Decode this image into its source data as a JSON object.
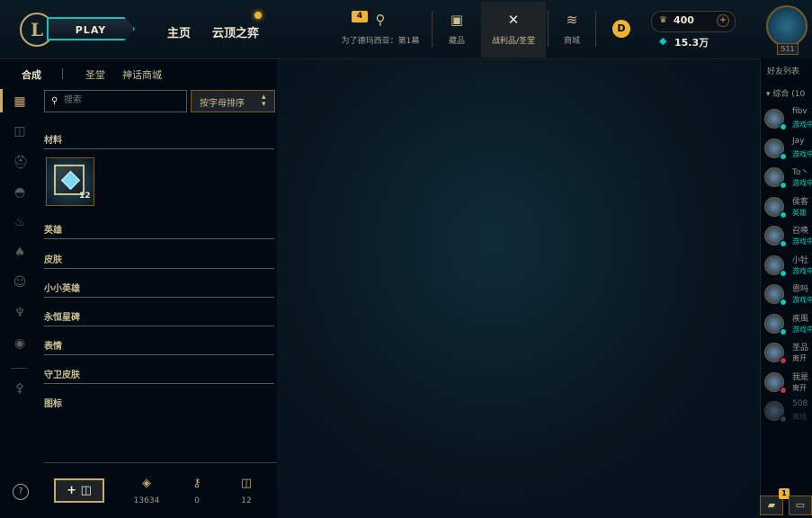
{
  "header": {
    "logo_letter": "L",
    "play_label": "PLAY",
    "nav": [
      "主页",
      "云顶之弈"
    ],
    "mission_badge": "4",
    "mission_label": "为了德玛西亚：第1幕",
    "tabs": [
      "藏品",
      "战利品/圣堂",
      "商城"
    ],
    "rp_coin_letter": "D",
    "rp_value": "400",
    "be_value": "15.3万",
    "level": "511"
  },
  "loot_tabs": [
    "合成",
    "圣堂",
    "神话商城"
  ],
  "search": {
    "placeholder": "搜索",
    "value": ""
  },
  "sort_label": "按字母排序",
  "categories": [
    "材料",
    "英雄",
    "皮肤",
    "小小英雄",
    "永恒星碑",
    "表情",
    "守卫皮肤",
    "图标"
  ],
  "loot_item": {
    "count": "12"
  },
  "bottom": {
    "craft_label": "+",
    "stats": [
      {
        "icon": "orange-essence-icon",
        "value": "13634"
      },
      {
        "icon": "key-icon",
        "value": "0"
      },
      {
        "icon": "chest-icon",
        "value": "12"
      }
    ]
  },
  "help_label": "?",
  "friends": {
    "title": "好友列表",
    "group_label": "综合 (10",
    "list": [
      {
        "name": "fibv",
        "status": "游戏中",
        "status_color": "#0ac8b9",
        "dot": "#0ac8b9"
      },
      {
        "name": "Jay",
        "status": "游戏中",
        "status_color": "#0ac8b9",
        "dot": "#0ac8b9"
      },
      {
        "name": "To丶",
        "status": "游戏中",
        "status_color": "#0ac8b9",
        "dot": "#0ac8b9"
      },
      {
        "name": "侯客",
        "status": "英雄",
        "status_color": "#0ac8b9",
        "dot": "#0ac8b9"
      },
      {
        "name": "召唤",
        "status": "游戏中",
        "status_color": "#0ac8b9",
        "dot": "#0ac8b9"
      },
      {
        "name": "小牡",
        "status": "游戏中",
        "status_color": "#0ac8b9",
        "dot": "#0ac8b9"
      },
      {
        "name": "恩吗",
        "status": "游戏中",
        "status_color": "#0ac8b9",
        "dot": "#0ac8b9"
      },
      {
        "name": "疾風",
        "status": "游戏中",
        "status_color": "#0ac8b9",
        "dot": "#0ac8b9"
      },
      {
        "name": "圣品",
        "status": "离开",
        "status_color": "#a09b8c",
        "dot": "#c83232"
      },
      {
        "name": "我是",
        "status": "离开",
        "status_color": "#a09b8c",
        "dot": "#c83232"
      },
      {
        "name": "508",
        "status": "离线",
        "status_color": "#5b5a56",
        "dot": "#5b5a56"
      }
    ]
  },
  "chat_badge": "1"
}
